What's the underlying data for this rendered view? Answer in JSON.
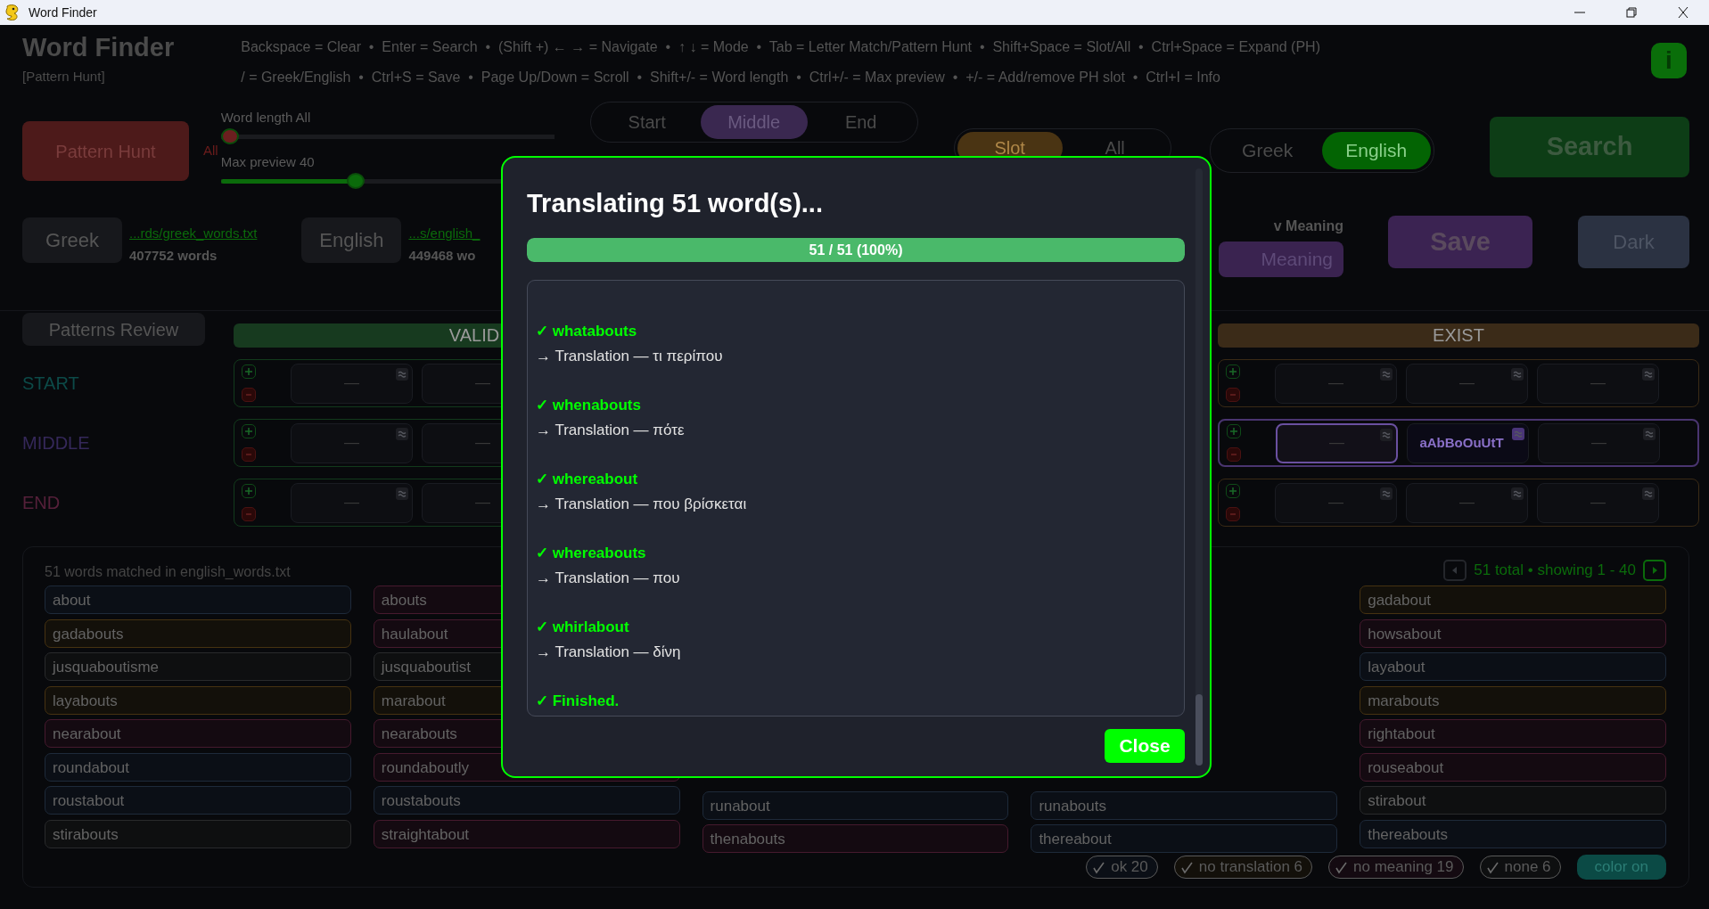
{
  "window": {
    "title": "Word Finder"
  },
  "header": {
    "title": "Word Finder",
    "mode": "[Pattern Hunt]",
    "shortcut_lines": [
      "Backspace = Clear  •  Enter = Search  •  (Shift +) ← → = Navigate  •  ↑ ↓ = Mode  •  Tab = Letter Match/Pattern Hunt  •  Shift+Space = Slot/All  •  Ctrl+Space = Expand (PH)",
      "/ = Greek/English  •  Ctrl+S = Save  •  Page Up/Down = Scroll  •  Shift+/- = Word length  •  Ctrl+/- = Max preview  •  +/- = Add/remove PH slot  •  Ctrl+I = Info"
    ],
    "info_button": "i"
  },
  "toolbar": {
    "mode_button": "Pattern Hunt",
    "length_marker": "All",
    "sliders": [
      {
        "label": "Word length  All",
        "level": 0,
        "color": "#6b1f1f"
      },
      {
        "label": "Max preview  40",
        "level": 0.4,
        "color": "#0b6b0b"
      }
    ],
    "positions": [
      {
        "label": "Start",
        "selected": false
      },
      {
        "label": "Middle",
        "selected": true
      },
      {
        "label": "End",
        "selected": false
      }
    ],
    "scope": [
      {
        "label": "Slot",
        "selected": true
      },
      {
        "label": "All",
        "selected": false
      }
    ],
    "languages": [
      {
        "label": "Greek",
        "selected": false
      },
      {
        "label": "English",
        "selected": true
      }
    ],
    "search_button": "Search"
  },
  "dictionaries": [
    {
      "button": "Greek",
      "path": "...rds/greek_words.txt",
      "count": "407752 words"
    },
    {
      "button": "English",
      "path": "...s/english_",
      "count": "449468 wo"
    }
  ],
  "meaning": {
    "label": "v Meaning",
    "button": "Meaning"
  },
  "save_button": "Save",
  "theme_button": "Dark",
  "patterns": {
    "review_button": "Patterns Review",
    "headers": [
      {
        "label": "VALID",
        "kind": "valid"
      },
      {
        "label": "EXIST",
        "kind": "exist"
      }
    ],
    "rows": [
      {
        "label": "START",
        "kind": "start",
        "selected": false,
        "valid_slots": [
          {
            "value": "—",
            "kind": "empty",
            "selected": false,
            "approx": true
          },
          {
            "value": "—",
            "kind": "empty",
            "selected": false
          }
        ],
        "exist_slots": [
          {
            "value": "—",
            "kind": "empty",
            "selected": false,
            "approx": true
          },
          {
            "value": "—",
            "kind": "empty",
            "selected": false,
            "approx": true
          },
          {
            "value": "—",
            "kind": "empty",
            "selected": false,
            "approx": true
          }
        ]
      },
      {
        "label": "MIDDLE",
        "kind": "middle",
        "selected": true,
        "valid_slots": [
          {
            "value": "—",
            "kind": "empty",
            "selected": false,
            "approx": true
          },
          {
            "value": "—",
            "kind": "empty",
            "selected": false
          }
        ],
        "exist_slots": [
          {
            "value": "—",
            "kind": "empty",
            "selected": true,
            "approx": true
          },
          {
            "value": "aAbBoOuUtT",
            "kind": "filled",
            "selected": false,
            "approx": true
          },
          {
            "value": "—",
            "kind": "empty",
            "selected": false,
            "approx": true
          }
        ]
      },
      {
        "label": "END",
        "kind": "end",
        "selected": false,
        "valid_slots": [
          {
            "value": "—",
            "kind": "empty",
            "selected": false,
            "approx": true
          },
          {
            "value": "—",
            "kind": "empty",
            "selected": false
          }
        ],
        "exist_slots": [
          {
            "value": "—",
            "kind": "empty",
            "selected": false,
            "approx": true
          },
          {
            "value": "—",
            "kind": "empty",
            "selected": false,
            "approx": true
          },
          {
            "value": "—",
            "kind": "empty",
            "selected": false,
            "approx": true
          }
        ]
      }
    ]
  },
  "results": {
    "summary": "51 words matched in english_words.txt",
    "pager": "51 total  •  showing 1 - 40",
    "columns": [
      [
        {
          "word": "about",
          "kind": "ok"
        },
        {
          "word": "gadabouts",
          "kind": "no_translation"
        },
        {
          "word": "jusquaboutisme",
          "kind": "none"
        },
        {
          "word": "layabouts",
          "kind": "no_translation"
        },
        {
          "word": "nearabout",
          "kind": "no_meaning"
        },
        {
          "word": "roundabout",
          "kind": "ok"
        },
        {
          "word": "roustabout",
          "kind": "ok"
        },
        {
          "word": "stirabouts",
          "kind": "none"
        }
      ],
      [
        {
          "word": "abouts",
          "kind": "no_meaning"
        },
        {
          "word": "haulabout",
          "kind": "no_meaning"
        },
        {
          "word": "jusquaboutist",
          "kind": "none"
        },
        {
          "word": "marabout",
          "kind": "no_translation"
        },
        {
          "word": "nearabouts",
          "kind": "no_meaning"
        },
        {
          "word": "roundaboutly",
          "kind": "no_meaning"
        },
        {
          "word": "roustabouts",
          "kind": "ok"
        },
        {
          "word": "straightabout",
          "kind": "no_meaning"
        }
      ],
      [
        {
          "word": "runabout",
          "kind": "ok"
        },
        {
          "word": "thenabouts",
          "kind": "no_meaning"
        }
      ],
      [
        {
          "word": "runabouts",
          "kind": "ok"
        },
        {
          "word": "thereabout",
          "kind": "ok"
        }
      ],
      [
        {
          "word": "gadabout",
          "kind": "no_translation"
        },
        {
          "word": "howsabout",
          "kind": "no_meaning"
        },
        {
          "word": "layabout",
          "kind": "ok"
        },
        {
          "word": "marabouts",
          "kind": "no_translation"
        },
        {
          "word": "rightabout",
          "kind": "no_meaning"
        },
        {
          "word": "rouseabout",
          "kind": "no_meaning"
        },
        {
          "word": "stirabout",
          "kind": "none"
        },
        {
          "word": "thereabouts",
          "kind": "ok"
        }
      ]
    ],
    "filters": [
      {
        "label": "ok 20",
        "kind": "ok",
        "checked": true
      },
      {
        "label": "no translation 6",
        "kind": "no_translation",
        "checked": true
      },
      {
        "label": "no meaning 19",
        "kind": "no_meaning",
        "checked": true
      },
      {
        "label": "none 6",
        "kind": "none",
        "checked": true
      }
    ],
    "color_toggle": "color on"
  },
  "dialog": {
    "title": "Translating 51 word(s)...",
    "progress": {
      "level": 1,
      "text": "51 / 51  (100%)"
    },
    "log": [
      {
        "kind": "word",
        "text": "✓ whatabouts"
      },
      {
        "kind": "translation",
        "text": "→ Translation — τι περίπου"
      },
      {
        "kind": "word",
        "text": "✓ whenabouts"
      },
      {
        "kind": "translation",
        "text": "→ Translation — πότε"
      },
      {
        "kind": "word",
        "text": "✓ whereabout"
      },
      {
        "kind": "translation",
        "text": "→ Translation — που βρίσκεται"
      },
      {
        "kind": "word",
        "text": "✓ whereabouts"
      },
      {
        "kind": "translation",
        "text": "→ Translation — που"
      },
      {
        "kind": "word",
        "text": "✓ whirlabout"
      },
      {
        "kind": "translation",
        "text": "→ Translation — δίνη"
      },
      {
        "kind": "done",
        "text": "✓ Finished."
      }
    ],
    "close_button": "Close"
  }
}
